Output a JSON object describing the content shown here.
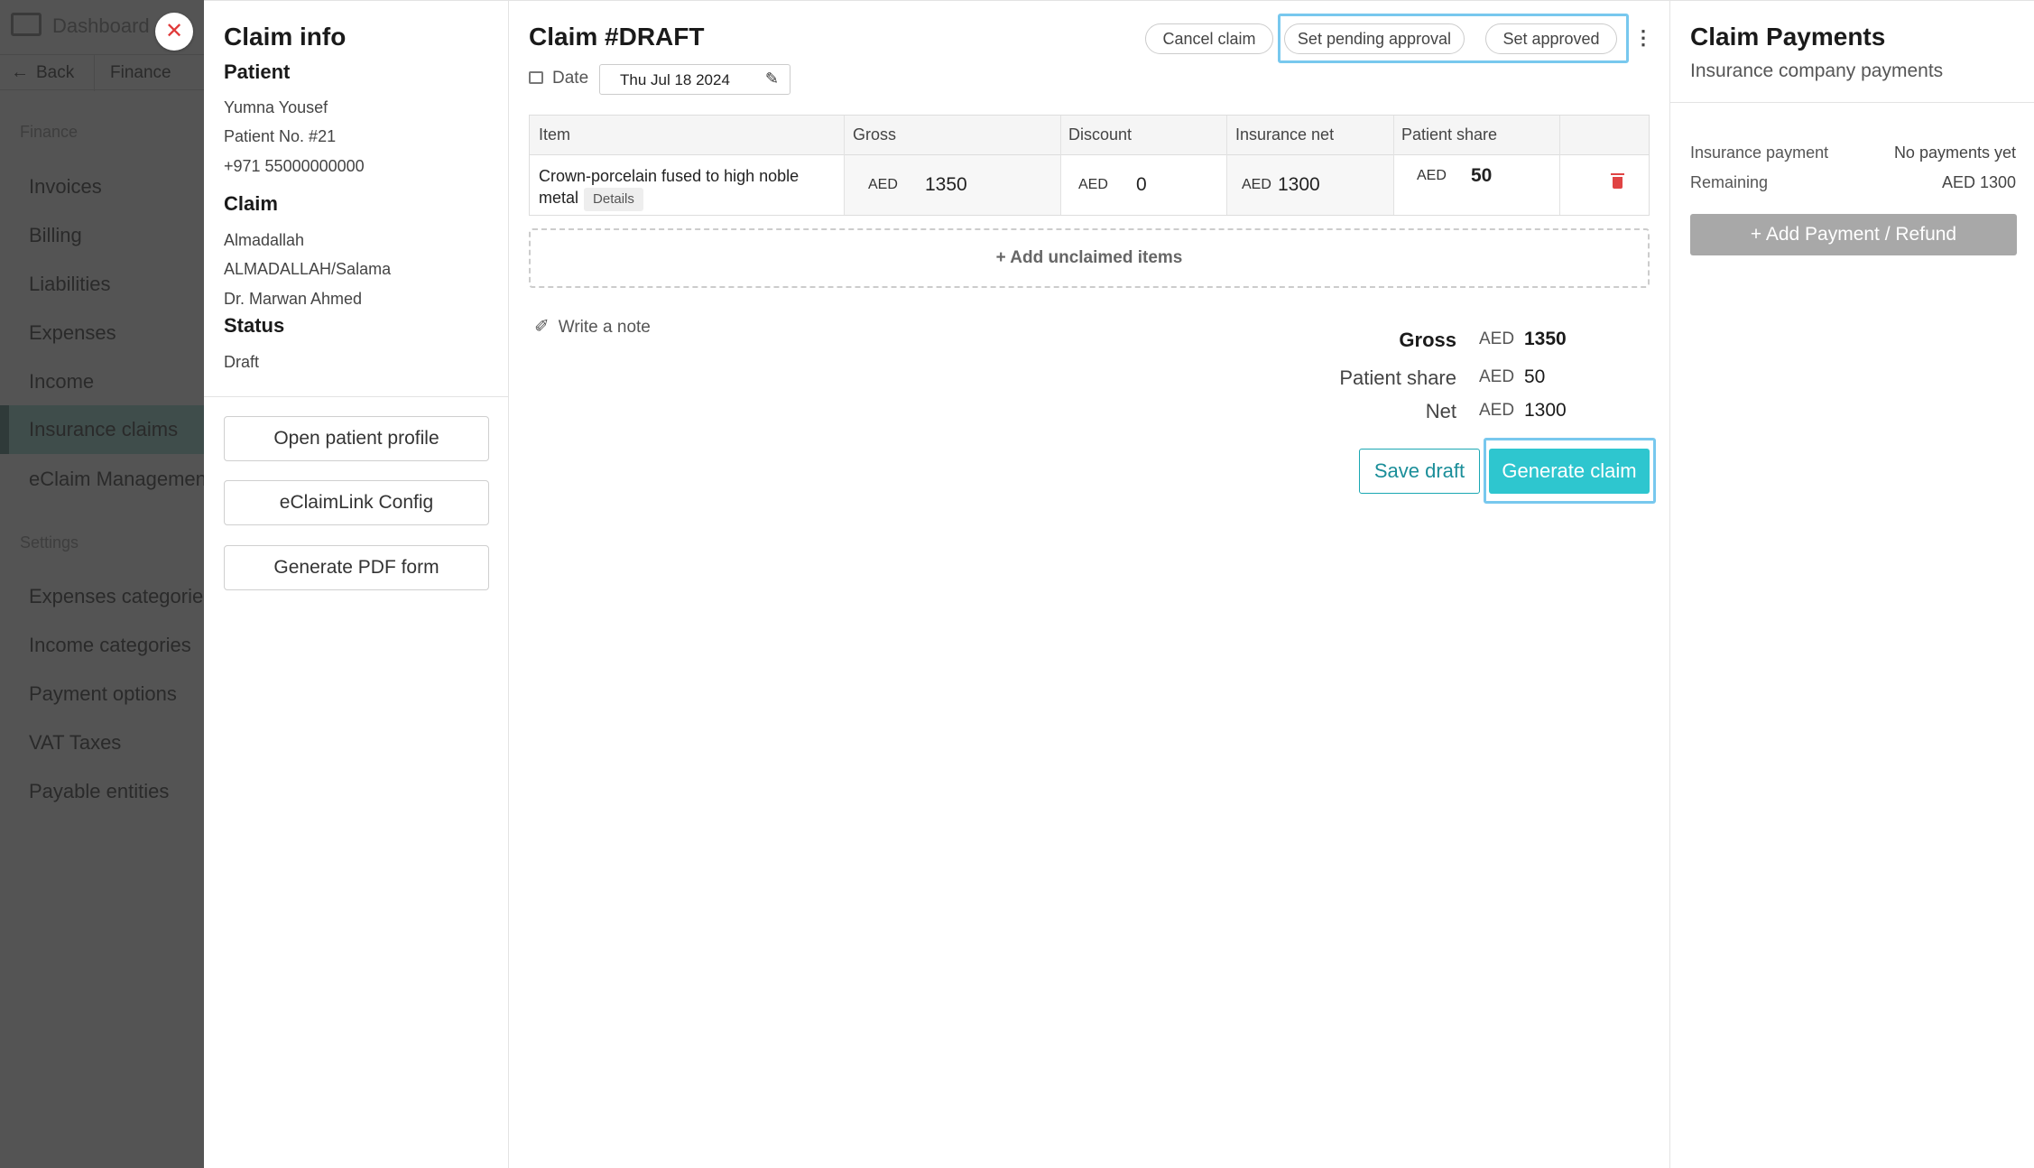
{
  "background_nav": {
    "dashboard_label": "Dashboard",
    "back_label": "Back",
    "finance_tab": "Finance",
    "finance_section": "Finance",
    "finance_items": [
      "Invoices",
      "Billing",
      "Liabilities",
      "Expenses",
      "Income",
      "Insurance claims",
      "eClaim Management"
    ],
    "settings_section": "Settings",
    "settings_items": [
      "Expenses categories",
      "Income categories",
      "Payment options",
      "VAT Taxes",
      "Payable entities"
    ],
    "close_symbol": "✕"
  },
  "claim_info": {
    "title": "Claim info",
    "patient_heading": "Patient",
    "patient_name": "Yumna Yousef",
    "patient_number": "Patient No. #21",
    "patient_phone": "+971 55000000000",
    "claim_heading": "Claim",
    "insurer": "Almadallah",
    "plan": "ALMADALLAH/Salama",
    "doctor": "Dr. Marwan Ahmed",
    "status_heading": "Status",
    "status_value": "Draft",
    "buttons": [
      "Open patient profile",
      "eClaimLink Config",
      "Generate PDF form"
    ]
  },
  "claim": {
    "title": "Claim #DRAFT",
    "date_label": "Date",
    "date_value": "Thu Jul 18 2024",
    "actions": {
      "cancel": "Cancel claim",
      "pending": "Set pending approval",
      "approved": "Set approved",
      "more": "⋮"
    },
    "table": {
      "headers": [
        "Item",
        "Gross",
        "Discount",
        "Insurance net",
        "Patient share"
      ],
      "row": {
        "item": "Crown-porcelain fused to high noble metal",
        "item_line1": "Crown-porcelain fused to high noble",
        "item_line2": "metal",
        "details": "Details",
        "currency": "AED",
        "gross": "1350",
        "discount": "0",
        "insurance_net": "1300",
        "patient_share": "50"
      }
    },
    "add_unclaimed": "+ Add unclaimed items",
    "write_note": "Write a note",
    "summary": {
      "gross_label": "Gross",
      "gross_currency": "AED",
      "gross_value": "1350",
      "patient_share_label": "Patient share",
      "patient_share_currency": "AED",
      "patient_share_value": "50",
      "net_label": "Net",
      "net_currency": "AED",
      "net_value": "1300"
    },
    "save_draft": "Save draft",
    "generate_claim": "Generate claim"
  },
  "payments": {
    "title": "Claim Payments",
    "subtitle": "Insurance company payments",
    "insurance_payment_label": "Insurance payment",
    "insurance_payment_value": "No payments yet",
    "remaining_label": "Remaining",
    "remaining_value": "AED 1300",
    "add_button": "+ Add Payment / Refund"
  },
  "colors": {
    "accent": "#2ec6cf",
    "highlight": "#78c8ee",
    "overlay_sidebar": "#545454",
    "danger": "#e04444"
  }
}
